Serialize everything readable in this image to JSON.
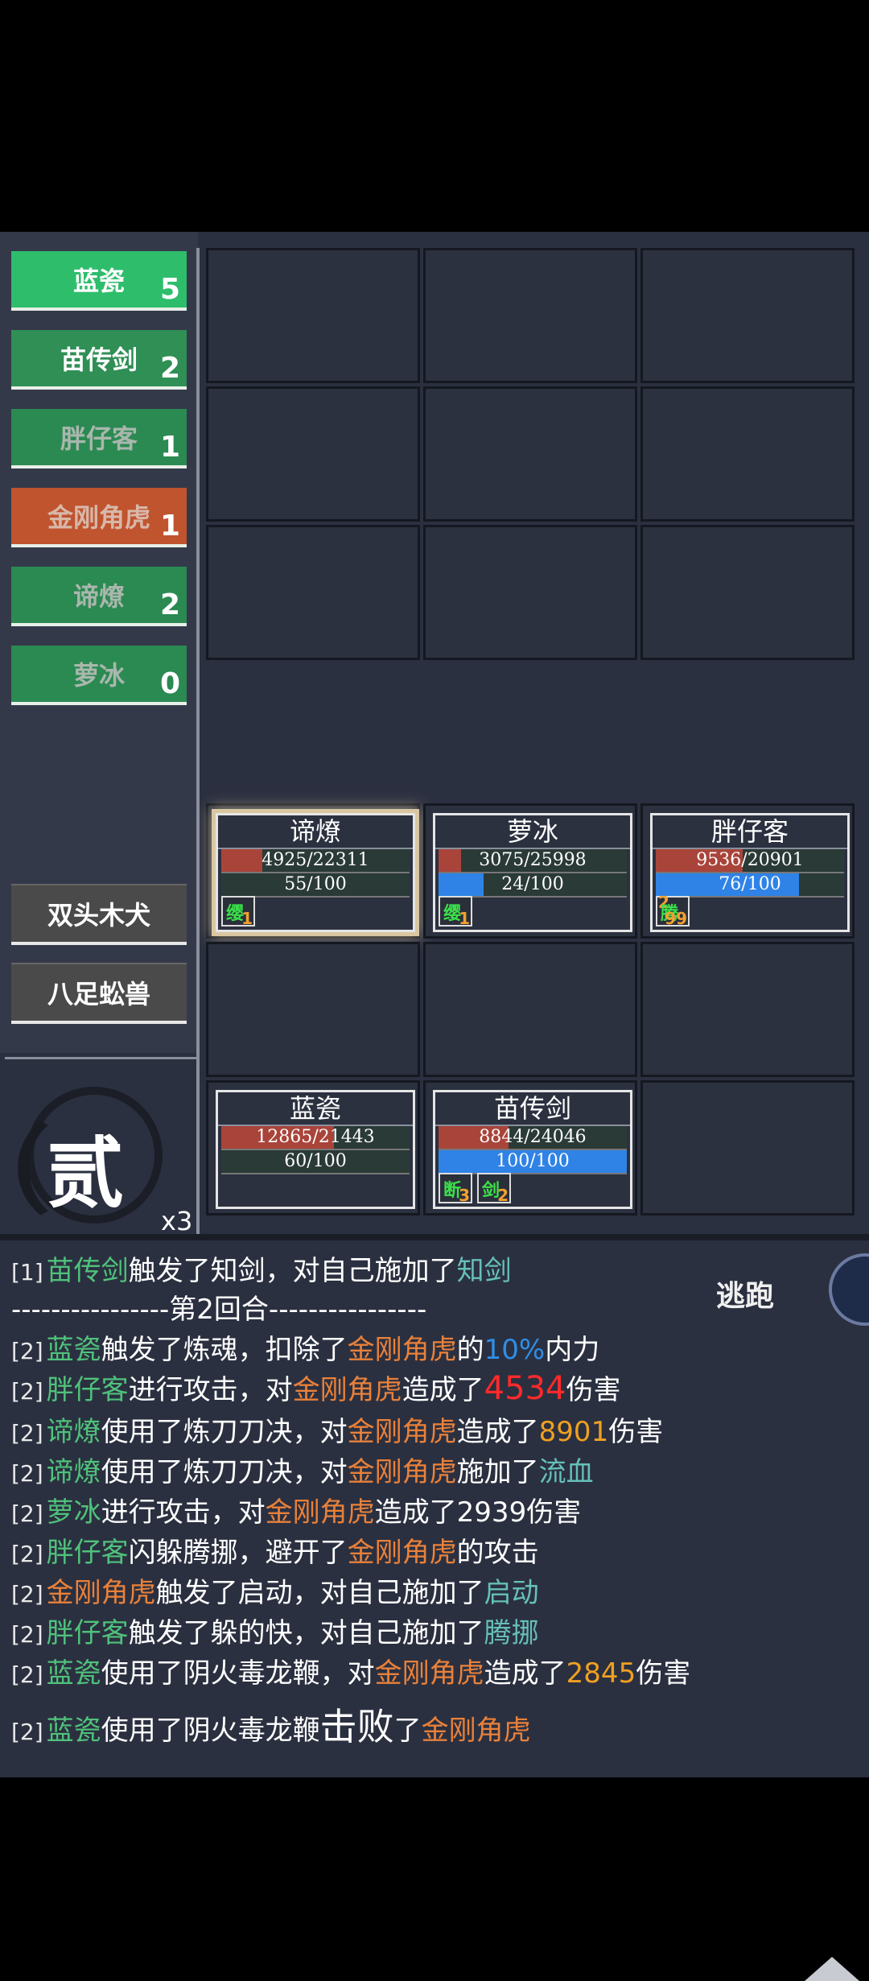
{
  "sidebar": {
    "allies": [
      {
        "name": "蓝瓷",
        "count": "5",
        "bg": "#2ebd6b",
        "text": "#ffffff"
      },
      {
        "name": "苗传剑",
        "count": "2",
        "bg": "#2f8f55",
        "text": "#ffffff"
      },
      {
        "name": "胖仔客",
        "count": "1",
        "bg": "#2b8a52",
        "text": "#a9b7ad"
      },
      {
        "name": "金刚角虎",
        "count": "1",
        "bg": "#c0542f",
        "text": "#d8b7a8"
      },
      {
        "name": "谛燎",
        "count": "2",
        "bg": "#2b8a52",
        "text": "#a9b7ad"
      },
      {
        "name": "萝冰",
        "count": "0",
        "bg": "#2b8a52",
        "text": "#a9b7ad"
      }
    ],
    "enemies": [
      "双头木犬",
      "八足蚣兽"
    ]
  },
  "round": {
    "char": "贰",
    "speed": "x3"
  },
  "field": {
    "cards": [
      {
        "name": "谛燎",
        "hp": "4925/22311",
        "hp_frac": 0.22,
        "mp": "55/100",
        "mp_frac": 0.0,
        "active": true,
        "buffs": [
          {
            "label": "缨",
            "stack": "1"
          }
        ]
      },
      {
        "name": "萝冰",
        "hp": "3075/25998",
        "hp_frac": 0.12,
        "mp": "24/100",
        "mp_frac": 0.24,
        "buffs": [
          {
            "label": "缨",
            "stack": "1"
          }
        ]
      },
      {
        "name": "胖仔客",
        "hp": "9536/20901",
        "hp_frac": 0.46,
        "mp": "76/100",
        "mp_frac": 0.76,
        "buffs": [
          {
            "label": "腾",
            "stack": "99",
            "pre": "2"
          }
        ]
      },
      {
        "name": "蓝瓷",
        "hp": "12865/21443",
        "hp_frac": 0.6,
        "mp": "60/100",
        "mp_frac": 0.0
      },
      {
        "name": "苗传剑",
        "hp": "8844/24046",
        "hp_frac": 0.37,
        "mp": "100/100",
        "mp_frac": 1.0,
        "buffs": [
          {
            "label": "断",
            "stack": "3"
          },
          {
            "label": "剑",
            "stack": "2"
          }
        ]
      }
    ]
  },
  "log": {
    "escape_label": "逃跑",
    "lines": [
      "[1] 苗传剑触发了知剑，对自己施加了知剑",
      "----------------第2回合----------------",
      "[2] 蓝瓷触发了炼魂，扣除了金刚角虎的10%内力",
      "[2] 胖仔客进行攻击，对金刚角虎造成了4534伤害",
      "[2] 谛燎使用了炼刀刀决，对金刚角虎造成了8901伤害",
      "[2] 谛燎使用了炼刀刀决，对金刚角虎施加了流血",
      "[2] 萝冰进行攻击，对金刚角虎造成了2939伤害",
      "[2] 胖仔客闪躲腾挪，避开了金刚角虎的攻击",
      "[2] 金刚角虎触发了启动，对自己施加了启动",
      "[2] 胖仔客触发了躲的快，对自己施加了腾挪",
      "[2] 蓝瓷使用了阴火毒龙鞭，对金刚角虎造成了2845伤害",
      "[2] 蓝瓷使用了阴火毒龙鞭击败了金刚角虎"
    ],
    "segments": {
      "l0": [
        "[1]",
        "苗传剑",
        "触发了知剑，对自己施加了",
        "知剑"
      ],
      "l1": [
        "----------------第2回合----------------"
      ],
      "l2": [
        "[2]",
        "蓝瓷",
        "触发了炼魂，扣除了",
        "金刚角虎",
        "的",
        "10%",
        "内力"
      ],
      "l3": [
        "[2]",
        "胖仔客",
        "进行攻击，对",
        "金刚角虎",
        "造成了",
        "4534",
        "伤害"
      ],
      "l4": [
        "[2]",
        "谛燎",
        "使用了炼刀刀决，对",
        "金刚角虎",
        "造成了",
        "8901",
        "伤害"
      ],
      "l5": [
        "[2]",
        "谛燎",
        "使用了炼刀刀决，对",
        "金刚角虎",
        "施加了",
        "流血"
      ],
      "l6": [
        "[2]",
        "萝冰",
        "进行攻击，对",
        "金刚角虎",
        "造成了2939伤害"
      ],
      "l7": [
        "[2]",
        "胖仔客",
        "闪躲腾挪，避开了",
        "金刚角虎",
        "的攻击"
      ],
      "l8": [
        "[2]",
        "金刚角虎",
        "触发了启动，对自己施加了",
        "启动"
      ],
      "l9": [
        "[2]",
        "胖仔客",
        "触发了躲的快，对自己施加了",
        "腾挪"
      ],
      "l10": [
        "[2]",
        "蓝瓷",
        "使用了阴火毒龙鞭，对",
        "金刚角虎",
        "造成了",
        "2845",
        "伤害"
      ],
      "l11": [
        "[2]",
        "蓝瓷",
        "使用了阴火毒龙鞭",
        "击败",
        "了",
        "金刚角虎"
      ]
    }
  }
}
